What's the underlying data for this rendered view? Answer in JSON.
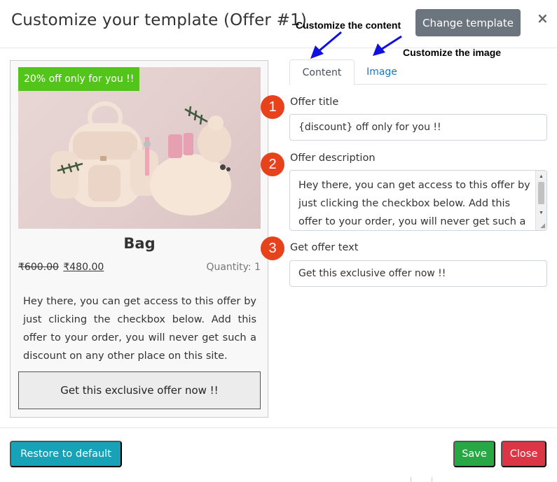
{
  "modal": {
    "title": "Customize your template (Offer #1)",
    "change_template_label": "Change template",
    "close_glyph": "×"
  },
  "annotations": {
    "content_label": "Customize the content",
    "image_label": "Customize the image",
    "arrow_color": "#1010e0",
    "steps": [
      "1",
      "2",
      "3"
    ],
    "step_color": "#e8421c"
  },
  "preview": {
    "badge": "20% off only for you !!",
    "badge_color": "#52c41a",
    "product_name": "Bag",
    "old_price": "₹600.00",
    "new_price": "₹480.00",
    "quantity": "Quantity: 1",
    "description": "Hey there, you can get access to this offer by just clicking the checkbox below. Add this offer to your order, you will never get such a discount on any other place on this site.",
    "button_label": "Get this exclusive offer now !!"
  },
  "tabs": [
    {
      "label": "Content",
      "active": true
    },
    {
      "label": "Image",
      "active": false
    }
  ],
  "form": {
    "offer_title_label": "Offer title",
    "offer_title_value": "{discount} off only for you !!",
    "offer_description_label": "Offer description",
    "offer_description_value": "Hey there, you can get access to this offer by just clicking the checkbox below. Add this offer to your order, you will never get such a",
    "get_offer_label": "Get offer text",
    "get_offer_value": "Get this exclusive offer now !!"
  },
  "footer": {
    "restore_label": "Restore to default",
    "save_label": "Save",
    "close_label": "Close",
    "restore_color": "#17a2b8",
    "save_color": "#28a745",
    "close_color": "#dc3545"
  }
}
